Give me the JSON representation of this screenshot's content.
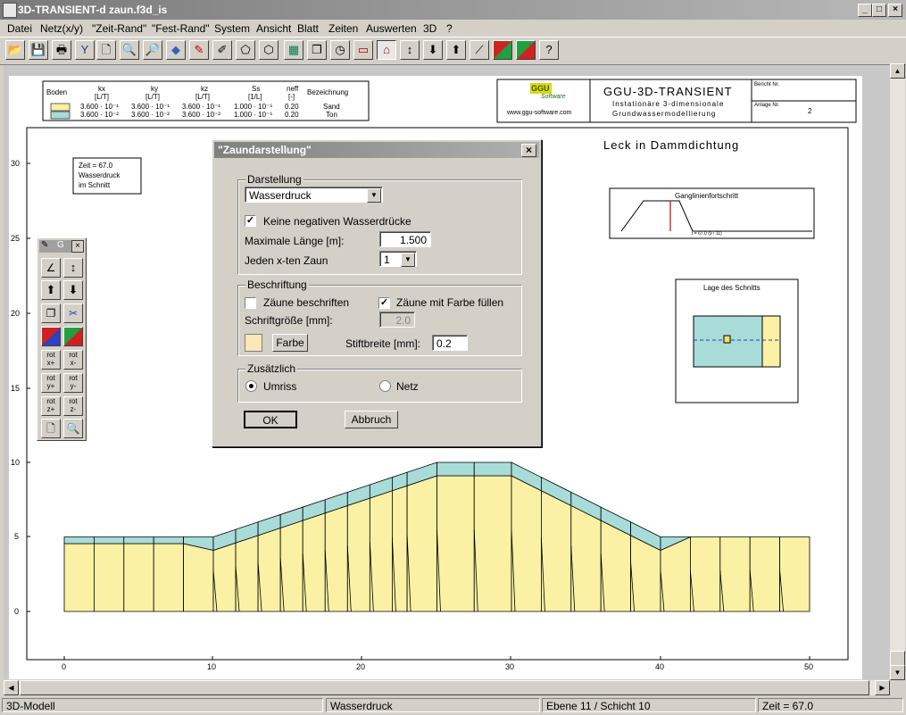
{
  "window": {
    "title": "3D-TRANSIENT-d zaun.f3d_is",
    "controls": {
      "minimize": "_",
      "maximize": "□",
      "close": "×"
    }
  },
  "menu": [
    "Datei",
    "Netz(x/y)",
    "\"Zeit-Rand\"",
    "\"Fest-Rand\"",
    "System",
    "Ansicht",
    "Blatt",
    "Zeiten",
    "Auswerten",
    "3D",
    "?"
  ],
  "toolbar": {
    "icons": [
      "open-folder-icon",
      "save-icon",
      "print-icon",
      "tools-icon",
      "zoom-page-icon",
      "zoom-out-icon",
      "zoom-in-icon",
      "move-icon",
      "paint-icon",
      "edit-icon",
      "polygon-icon",
      "grid-icon",
      "copy-icon",
      "clock-icon",
      "window-icon",
      "diagram-icon",
      "double-arrow-icon",
      "arrow-down-icon",
      "arrow-up-icon",
      "line-icon",
      "color-map-icon",
      "color-map-2-icon",
      "help-icon"
    ],
    "help_label": "?"
  },
  "header": {
    "legend": {
      "col_boden": "Boden",
      "col_kx": "kx",
      "col_ky": "ky",
      "col_kz": "kz",
      "col_ss": "Ss",
      "col_neff": "neff",
      "col_bez": "Bezeichnung",
      "unit_kx": "[L/T]",
      "unit_ky": "[L/T]",
      "unit_kz": "[L/T]",
      "unit_ss": "[1/L]",
      "unit_neff": "[-]",
      "rows": [
        {
          "color": "#fbf1a4",
          "kx": "3.600 · 10⁻¹",
          "ky": "3.600 · 10⁻¹",
          "kz": "3.600 · 10⁻¹",
          "ss": "1.000 · 10⁻⁵",
          "neff": "0.20",
          "name": "Sand"
        },
        {
          "color": "#a8dcd8",
          "kx": "3.600 · 10⁻²",
          "ky": "3.600 · 10⁻²",
          "kz": "3.600 · 10⁻²",
          "ss": "1.000 · 10⁻⁵",
          "neff": "0.20",
          "name": "Ton"
        }
      ]
    },
    "logo_text": "GGU",
    "logo_sub": "Software",
    "website": "www.ggu-software.com",
    "program": "GGU-3D-TRANSIENT",
    "subtitle1": "Instationäre 3-dimensionale",
    "subtitle2": "Grundwassermodellierung",
    "bericht_label": "Bericht Nr.",
    "bericht_value": "",
    "anlage_label": "Anlage Nr.",
    "anlage_value": "2"
  },
  "plot": {
    "title": "Leck in Dammdichtung",
    "info_line1": "Zeit = 67.0",
    "info_line2": "Wasserdruck",
    "info_line3": "im Schnitt",
    "ganglinie_title": "Ganglinienfortschritt",
    "ganglinie_label": "t = 67.0  (9 / 11)",
    "schnitt_title": "Lage des Schnitts",
    "y_ticks": [
      "30",
      "25",
      "20",
      "15",
      "10",
      "5",
      "0"
    ],
    "x_ticks": [
      "0",
      "10",
      "20",
      "30",
      "40",
      "50"
    ],
    "colors": {
      "sand": "#fbf1a4",
      "ton": "#a8dcd8"
    }
  },
  "dialog": {
    "title": "\"Zaundarstellung\"",
    "close": "×",
    "darstellung": {
      "label": "Darstellung",
      "mode_value": "Wasserdruck",
      "no_negative_label": "Keine negativen Wasserdrücke",
      "no_negative_checked": true,
      "max_length_label": "Maximale Länge [m]:",
      "max_length_value": "1.500",
      "every_nth_label": "Jeden x-ten Zaun",
      "every_nth_value": "1"
    },
    "beschriftung": {
      "label": "Beschriftung",
      "label_fences": "Zäune beschriften",
      "label_fences_checked": false,
      "fill_color_label": "Zäune mit Farbe füllen",
      "fill_color_checked": true,
      "font_size_label": "Schriftgröße [mm]:",
      "font_size_value": "2.0",
      "color_button": "Farbe",
      "pen_width_label": "Stiftbreite [mm]:",
      "pen_width_value": "0.2",
      "swatch_color": "#fbe6b8"
    },
    "zusaetzlich": {
      "label": "Zusätzlich",
      "option_umriss": "Umriss",
      "option_netz": "Netz",
      "selected": "Umriss"
    },
    "ok": "OK",
    "cancel": "Abbruch"
  },
  "palette": {
    "title_glyph": "G",
    "close": "×",
    "rot_buttons": [
      {
        "line1": "rot",
        "line2": "x+"
      },
      {
        "line1": "rot",
        "line2": "x-"
      },
      {
        "line1": "rot",
        "line2": "y+"
      },
      {
        "line1": "rot",
        "line2": "y-"
      },
      {
        "line1": "rot",
        "line2": "z+"
      },
      {
        "line1": "rot",
        "line2": "z-"
      }
    ]
  },
  "status": {
    "model": "3D-Modell",
    "mode": "Wasserdruck",
    "layer": "Ebene 11 / Schicht 10",
    "time": "Zeit = 67.0"
  }
}
